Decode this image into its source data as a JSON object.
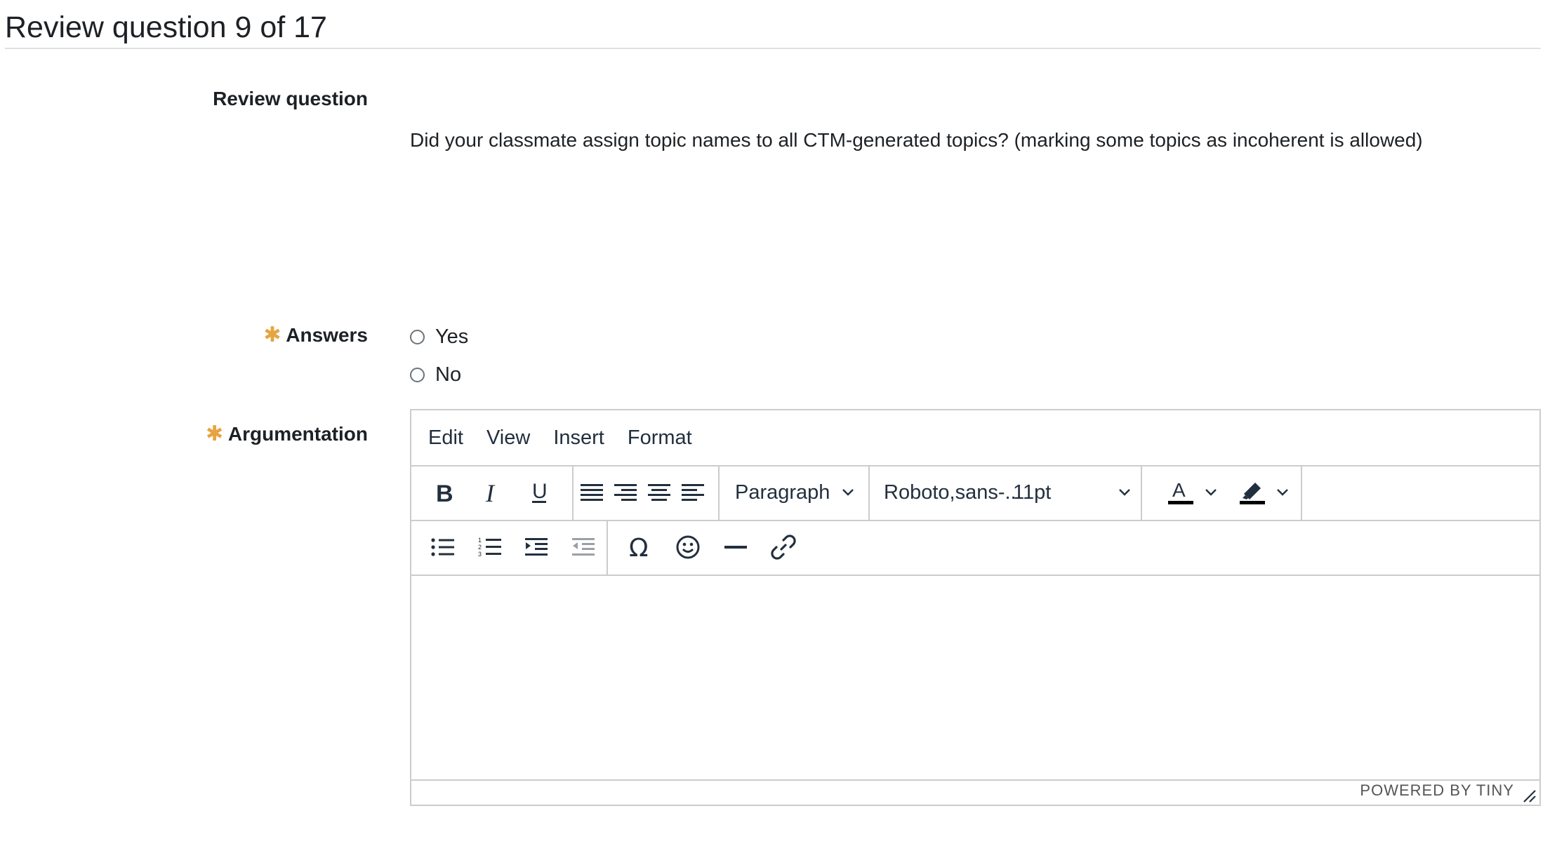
{
  "page_title": "Review question 9 of 17",
  "review_question": {
    "label": "Review question",
    "text": "Did your classmate assign topic names to all CTM-generated topics? (marking some topics as incoherent is allowed)"
  },
  "answers": {
    "label": "Answers",
    "required_icon": "asterisk-icon",
    "options": [
      {
        "label": "Yes",
        "selected": false
      },
      {
        "label": "No",
        "selected": false
      }
    ]
  },
  "argumentation": {
    "label": "Argumentation",
    "required_icon": "asterisk-icon"
  },
  "editor": {
    "menu": [
      "Edit",
      "View",
      "Insert",
      "Format"
    ],
    "block_format": "Paragraph",
    "font_family": "Roboto,sans-...",
    "font_size": "11pt",
    "content": "",
    "powered_by": "POWERED BY TINY",
    "icons": [
      "bold-icon",
      "italic-icon",
      "underline-icon",
      "align-justify-icon",
      "align-right-icon",
      "align-center-icon",
      "align-left-icon",
      "text-color-icon",
      "highlight-icon",
      "bullet-list-icon",
      "numbered-list-icon",
      "indent-icon",
      "outdent-icon",
      "special-character-icon",
      "emoji-icon",
      "horizontal-line-icon",
      "link-icon"
    ]
  },
  "colors": {
    "required": "#e6a441",
    "text": "#1d2125",
    "border": "#cccccc",
    "disabled_icon": "#9aa0a6"
  }
}
